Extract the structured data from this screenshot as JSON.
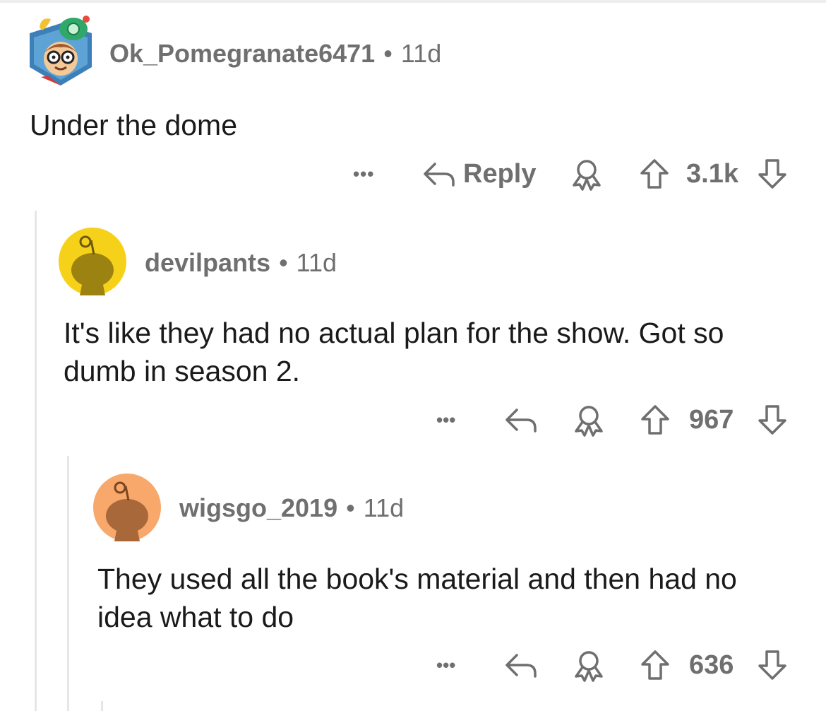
{
  "comments": [
    {
      "username": "Ok_Pomegranate6471",
      "separator": "•",
      "age": "11d",
      "body": "Under the dome",
      "more_label": "•••",
      "reply_label": "Reply",
      "score": "3.1k"
    },
    {
      "username": "devilpants",
      "separator": "•",
      "age": "11d",
      "body": "It's like they had no actual plan for the show. Got so dumb in season 2.",
      "more_label": "•••",
      "score": "967",
      "avatar_color": "#f5d11a"
    },
    {
      "username": "wigsgo_2019",
      "separator": "•",
      "age": "11d",
      "body": "They used all the book's material and then had no idea what to do",
      "more_label": "•••",
      "score": "636",
      "avatar_color": "#f7a86a"
    }
  ],
  "colors": {
    "meta_text": "#6f6f6f",
    "body_text": "#1a1a1b",
    "thread_line": "#e6e6e6"
  },
  "icons": [
    "reply-arrow-icon",
    "award-icon",
    "upvote-icon",
    "downvote-icon",
    "more-options-icon",
    "snoo-avatar-icon"
  ]
}
